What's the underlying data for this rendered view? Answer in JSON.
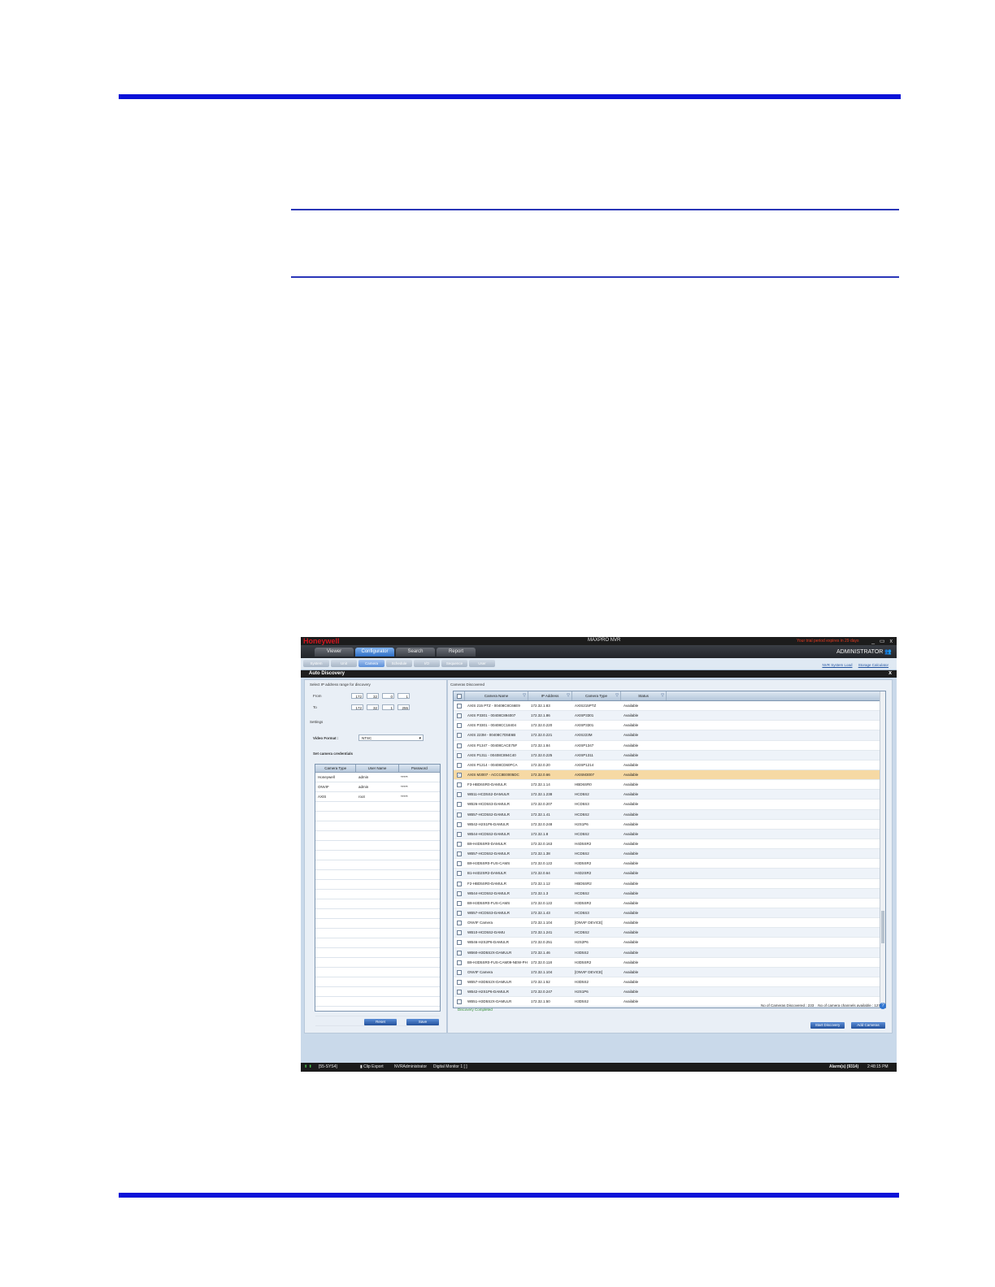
{
  "app": {
    "brand": "Honeywell",
    "title": "MAXPRO NVR",
    "warning": "Your trial period expires in 29 days",
    "window_buttons": "_ ▭ x",
    "user": "ADMINISTRATOR"
  },
  "main_tabs": [
    "Viewer",
    "Configurator",
    "Search",
    "Report"
  ],
  "sub_tabs": [
    "System",
    "Unit",
    "Camera",
    "Schedule",
    "I/O",
    "Sequence",
    "User"
  ],
  "sub_links": [
    "NVR System Load",
    "Storage Calculator"
  ],
  "dialog": {
    "title": "Auto Discovery",
    "close": "x"
  },
  "left_panel": {
    "ip_range_label": "Select IP address range for discovery",
    "from_label": "From",
    "from": [
      "172",
      "32",
      "0",
      "1"
    ],
    "to_label": "To",
    "to": [
      "172",
      "32",
      "1",
      "255"
    ],
    "settings_label": "Settings",
    "video_format_label": "Video Format :",
    "video_format_value": "NTSC",
    "credentials_label": "Set camera credentials",
    "cred_headers": [
      "Camera Type",
      "User Name",
      "Password"
    ],
    "credentials": [
      {
        "type": "Honeywell",
        "user": "admin",
        "password": "*****"
      },
      {
        "type": "ONVIF",
        "user": "admin",
        "password": "*****"
      },
      {
        "type": "AXIS",
        "user": "root",
        "password": "*****"
      }
    ],
    "reset_button": "Reset",
    "save_button": "Save"
  },
  "right_panel": {
    "label": "Cameras Discovered",
    "headers": [
      "Camera Name",
      "IP Address",
      "Camera Type",
      "Status"
    ],
    "rows": [
      {
        "name": "AXIS 215 PTZ - 00408C8C66E9",
        "ip": "172.32.1.83",
        "type": "AXIS215PTZ",
        "status": "Available"
      },
      {
        "name": "AXIS P3301 - 00408C894007",
        "ip": "172.32.1.86",
        "type": "AXISP3301",
        "status": "Available"
      },
      {
        "name": "AXIS P3301 - 00408CC18404",
        "ip": "172.32.0.220",
        "type": "AXISP3301",
        "status": "Available"
      },
      {
        "name": "AXIS 223M - 00408C7D5E6B",
        "ip": "172.32.0.221",
        "type": "AXIS223M",
        "status": "Available"
      },
      {
        "name": "AXIS P1347 - 00408CACE75F",
        "ip": "172.32.1.84",
        "type": "AXISP1347",
        "status": "Available"
      },
      {
        "name": "AXIS P1311 - 00408C894C40",
        "ip": "172.32.0.225",
        "type": "AXISP1311",
        "status": "Available"
      },
      {
        "name": "AXIS P1214 - 00408CD60FCA",
        "ip": "172.32.0.20",
        "type": "AXISP1214",
        "status": "Available"
      },
      {
        "name": "AXIS M3007 - ACCC8E0005DC",
        "ip": "172.32.0.66",
        "type": "AXISM3007",
        "status": "Available",
        "selected": true
      },
      {
        "name": "F3-HBD6SR0-DAMULR",
        "ip": "172.32.1.14",
        "type": "HBD6SR0",
        "status": "Available"
      },
      {
        "name": "WB11-HCD5S2-DAMULR",
        "ip": "172.32.1.238",
        "type": "HCD5S2",
        "status": "Available"
      },
      {
        "name": "WB26-HCD5S3-DAMULR",
        "ip": "172.32.0.207",
        "type": "HCD5S3",
        "status": "Available"
      },
      {
        "name": "WB57-HCD5S2-DAMULR",
        "ip": "172.32.1.41",
        "type": "HCD5S2",
        "status": "Available"
      },
      {
        "name": "WB42-H2S1P6-DAMULR",
        "ip": "172.32.0.248",
        "type": "H2S1P6",
        "status": "Available"
      },
      {
        "name": "WB44-HCD5S2-DAMULR",
        "ip": "172.32.1.8",
        "type": "HCD5S2",
        "status": "Available"
      },
      {
        "name": "B9-H4D5SR0-DAMULR",
        "ip": "172.32.0.163",
        "type": "H4D5SR2",
        "status": "Available"
      },
      {
        "name": "WB57-HCD5S2-DAMULR",
        "ip": "172.32.1.38",
        "type": "HCD5S2",
        "status": "Available"
      },
      {
        "name": "B9-H3D5SR0-FUS-CAMS",
        "ip": "172.32.0.122",
        "type": "H3D5SR2",
        "status": "Available"
      },
      {
        "name": "B1-H4D2SR2-DAMULR",
        "ip": "172.32.0.64",
        "type": "H4D2SR2",
        "status": "Available"
      },
      {
        "name": "F2-HBD5SR0-DAMULR",
        "ip": "172.32.1.12",
        "type": "HBD5SR2",
        "status": "Available"
      },
      {
        "name": "WB44-HCD5S2-DAMULR",
        "ip": "172.32.1.3",
        "type": "HCD5S2",
        "status": "Available"
      },
      {
        "name": "B9-H3D5SR0-FUS-CAMS",
        "ip": "172.32.0.122",
        "type": "H3D5SR2",
        "status": "Available"
      },
      {
        "name": "WB57-HCD5S3-DAMULR",
        "ip": "172.32.1.43",
        "type": "HCD5S3",
        "status": "Available"
      },
      {
        "name": "ONVIF Camera",
        "ip": "172.32.1.104",
        "type": "[ONVIF DEVICE]",
        "status": "Available"
      },
      {
        "name": "WB10-HCD5S2-DAMU",
        "ip": "172.32.1.241",
        "type": "HCD5S2",
        "status": "Available"
      },
      {
        "name": "WB46-H2S2P6-DAMULR",
        "ip": "172.32.0.251",
        "type": "H2S2P6",
        "status": "Available"
      },
      {
        "name": "WB60-H3D5S2X-DAMULR",
        "ip": "172.32.1.46",
        "type": "H3D5S2",
        "status": "Available"
      },
      {
        "name": "B9-H3D5SR0-FUS-CAM09-NEW-PH",
        "ip": "172.32.0.118",
        "type": "H3D5SR2",
        "status": "Available"
      },
      {
        "name": "ONVIF Camera",
        "ip": "172.32.1.104",
        "type": "[ONVIF DEVICE]",
        "status": "Available"
      },
      {
        "name": "WB57-H3D5S2X-DAMULR",
        "ip": "172.32.1.52",
        "type": "H3D5S2",
        "status": "Available"
      },
      {
        "name": "WB42-H2S1P6-DAMULR",
        "ip": "172.32.0.247",
        "type": "H2S1P6",
        "status": "Available"
      },
      {
        "name": "WB51-H3D5S2X-DAMULR",
        "ip": "172.32.1.50",
        "type": "H3D5S2",
        "status": "Available"
      },
      {
        "name": "B9-H3D5SR0-DAMULR",
        "ip": "172.32.0.113",
        "type": "H3D5SR2",
        "status": "Available"
      },
      {
        "name": "B9-H3D5SR0-DAMULR",
        "ip": "172.32.0.110",
        "type": "H3D5SR2",
        "status": "Available"
      },
      {
        "name": "B9-H4D2SR0-DAMULR",
        "ip": "172.32.0.107",
        "type": "H4D2SR2",
        "status": "Available"
      }
    ],
    "discovery_status": "Discovery Completed",
    "cameras_discovered": "No of Cameras Discovered : 233",
    "channels_available": "No of camera channels available : 127",
    "help": "?",
    "start_button": "Start Discovery",
    "add_button": "Add Cameras"
  },
  "statusbar": {
    "indicators": "⬆ ⬆",
    "server": "[55-SYS4]",
    "clip_export": "Clip Export",
    "user": "NVRAdministrator",
    "digital_monitor": "Digital Monitor  1 [  ]",
    "alarms": "Alarm(s) (9314)",
    "time": "2:48:15 PM"
  },
  "colors": {
    "page_rule": "#0a12d8",
    "brand_red": "#d2161f",
    "selected_row": "#f6d9a4",
    "active_tab": "#2f6fc5"
  }
}
